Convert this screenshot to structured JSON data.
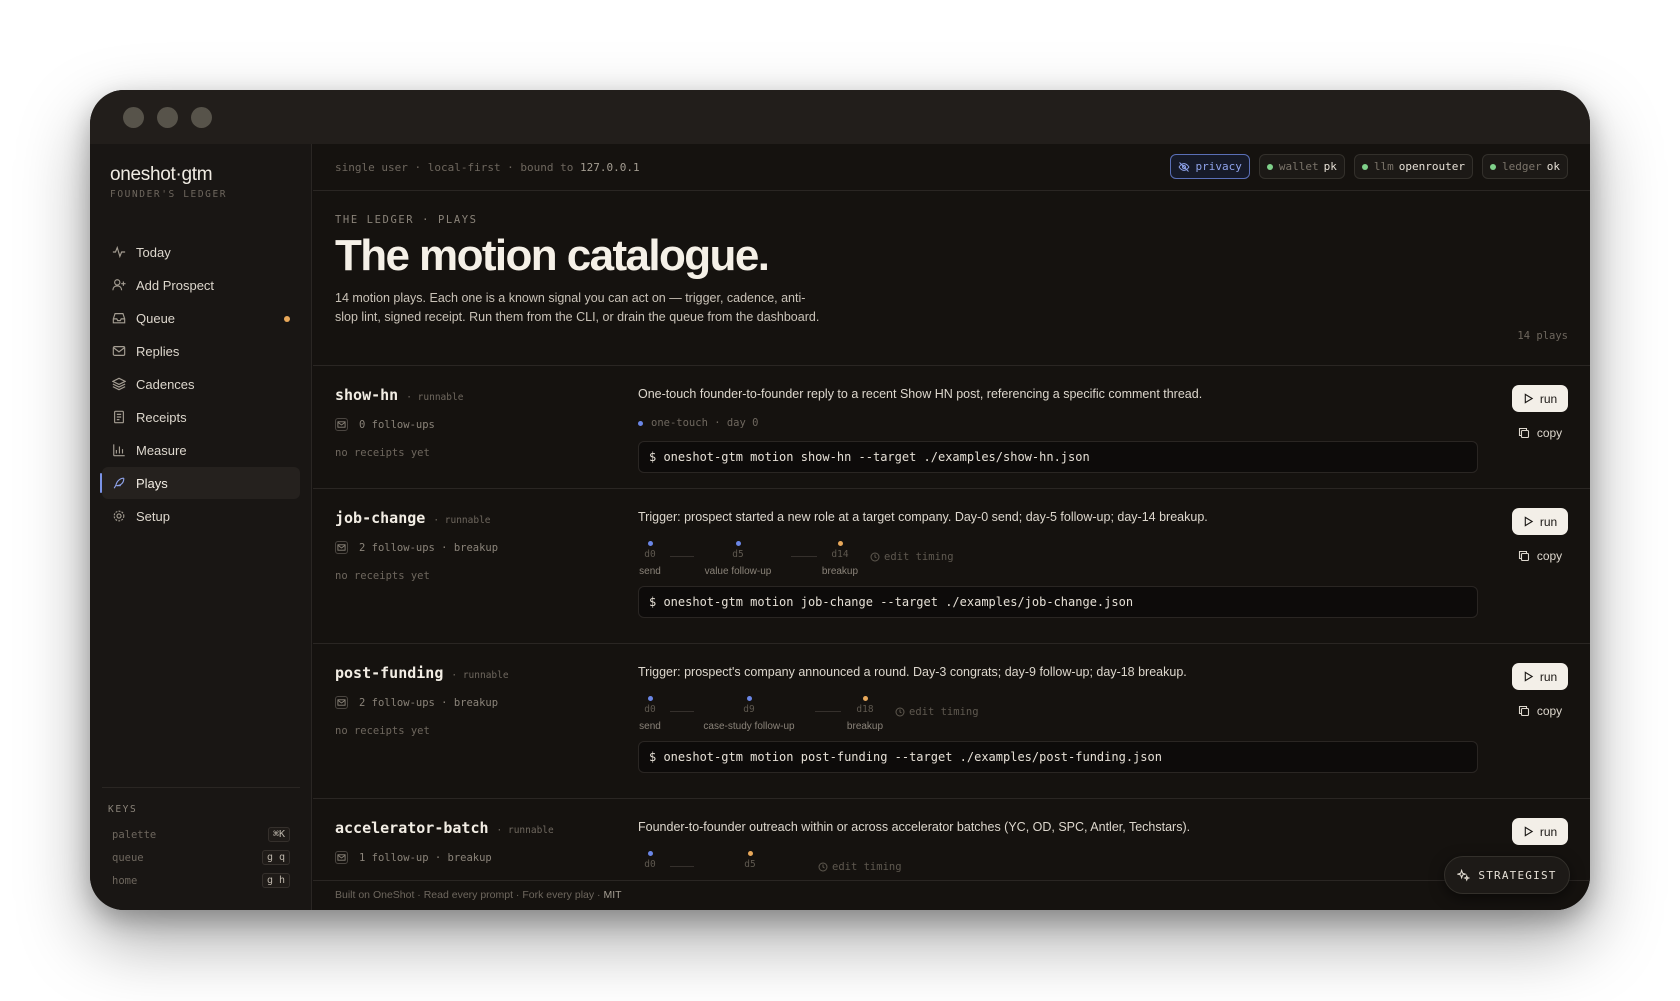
{
  "sidebar": {
    "brand": "oneshot·gtm",
    "brand_sub": "FOUNDER'S LEDGER",
    "items": [
      {
        "label": "Today",
        "icon": "activity-icon"
      },
      {
        "label": "Add Prospect",
        "icon": "user-plus-icon"
      },
      {
        "label": "Queue",
        "icon": "inbox-icon"
      },
      {
        "label": "Replies",
        "icon": "mail-icon"
      },
      {
        "label": "Cadences",
        "icon": "layers-icon"
      },
      {
        "label": "Receipts",
        "icon": "receipt-icon"
      },
      {
        "label": "Measure",
        "icon": "bar-chart-icon"
      },
      {
        "label": "Plays",
        "icon": "feather-icon"
      },
      {
        "label": "Setup",
        "icon": "gear-icon"
      }
    ],
    "active": "Plays",
    "keys_title": "KEYS",
    "keys": [
      {
        "label": "palette",
        "kbd": "⌘K"
      },
      {
        "label": "queue",
        "kbd": "g q"
      },
      {
        "label": "home",
        "kbd": "g h"
      }
    ]
  },
  "topbar": {
    "left_text": "single user · local-first · bound to",
    "ip": "127.0.0.1",
    "privacy": "privacy",
    "wallet_label": "wallet",
    "wallet_value": "pk",
    "llm_label": "llm",
    "llm_value": "openrouter",
    "ledger_label": "ledger",
    "ledger_value": "ok"
  },
  "hero": {
    "eyebrow": "THE LEDGER · PLAYS",
    "title": "The motion catalogue.",
    "description": "14 motion plays. Each one is a known signal you can act on — trigger, cadence, anti-slop lint, signed receipt. Run them from the CLI, or drain the queue from the dashboard.",
    "count": "14 plays"
  },
  "plays": [
    {
      "name": "show-hn",
      "status": "runnable",
      "followups": "0 follow-ups",
      "receipts": "no receipts yet",
      "description": "One-touch founder-to-founder reply to a recent Show HN post, referencing a specific comment thread.",
      "onetouch": "one-touch · day 0",
      "command": "$ oneshot-gtm motion show-hn --target ./examples/show-hn.json",
      "run": "run",
      "copy": "copy"
    },
    {
      "name": "job-change",
      "status": "runnable",
      "followups": "2 follow-ups · breakup",
      "receipts": "no receipts yet",
      "description": "Trigger: prospect started a new role at a target company. Day-0 send; day-5 follow-up; day-14 breakup.",
      "steps": [
        {
          "day": "d0",
          "label": "send",
          "color": "#6a86e6"
        },
        {
          "day": "d5",
          "label": "value follow-up",
          "color": "#6a86e6"
        },
        {
          "day": "d14",
          "label": "breakup",
          "color": "#e8a85a"
        }
      ],
      "edit": "edit timing",
      "command": "$ oneshot-gtm motion job-change --target ./examples/job-change.json",
      "run": "run",
      "copy": "copy"
    },
    {
      "name": "post-funding",
      "status": "runnable",
      "followups": "2 follow-ups · breakup",
      "receipts": "no receipts yet",
      "description": "Trigger: prospect's company announced a round. Day-3 congrats; day-9 follow-up; day-18 breakup.",
      "steps": [
        {
          "day": "d0",
          "label": "send",
          "color": "#6a86e6"
        },
        {
          "day": "d9",
          "label": "case-study follow-up",
          "color": "#6a86e6"
        },
        {
          "day": "d18",
          "label": "breakup",
          "color": "#e8a85a"
        }
      ],
      "edit": "edit timing",
      "command": "$ oneshot-gtm motion post-funding --target ./examples/post-funding.json",
      "run": "run",
      "copy": "copy"
    },
    {
      "name": "accelerator-batch",
      "status": "runnable",
      "followups": "1 follow-up · breakup",
      "description": "Founder-to-founder outreach within or across accelerator batches (YC, OD, SPC, Antler, Techstars).",
      "steps": [
        {
          "day": "d0",
          "color": "#6a86e6"
        },
        {
          "day": "d5",
          "color": "#e8a85a"
        }
      ],
      "edit": "edit timing",
      "run": "run"
    }
  ],
  "footer": {
    "text": "Built on OneShot · Read every prompt · Fork every play ·",
    "license": "MIT"
  },
  "strategist": "STRATEGIST"
}
